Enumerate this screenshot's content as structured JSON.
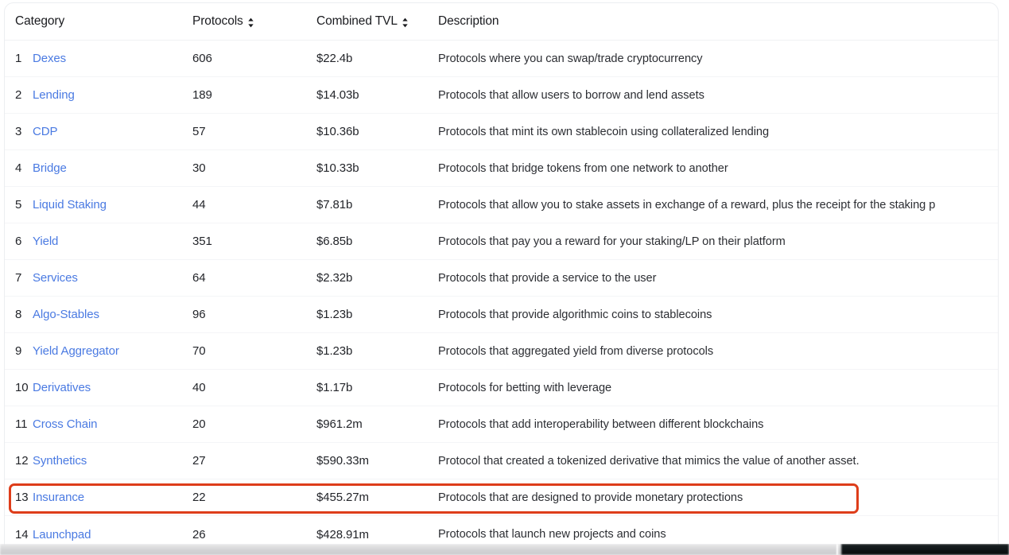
{
  "table": {
    "columns": {
      "category": "Category",
      "protocols": "Protocols",
      "combined_tvl": "Combined TVL",
      "description": "Description"
    },
    "sort_icon_name": "sort-updown-icon",
    "rows": [
      {
        "rank": "1",
        "category": "Dexes",
        "protocols": "606",
        "combined_tvl": "$22.4b",
        "description": "Protocols where you can swap/trade cryptocurrency"
      },
      {
        "rank": "2",
        "category": "Lending",
        "protocols": "189",
        "combined_tvl": "$14.03b",
        "description": "Protocols that allow users to borrow and lend assets"
      },
      {
        "rank": "3",
        "category": "CDP",
        "protocols": "57",
        "combined_tvl": "$10.36b",
        "description": "Protocols that mint its own stablecoin using collateralized lending"
      },
      {
        "rank": "4",
        "category": "Bridge",
        "protocols": "30",
        "combined_tvl": "$10.33b",
        "description": "Protocols that bridge tokens from one network to another"
      },
      {
        "rank": "5",
        "category": "Liquid Staking",
        "protocols": "44",
        "combined_tvl": "$7.81b",
        "description": "Protocols that allow you to stake assets in exchange of a reward, plus the receipt for the staking p"
      },
      {
        "rank": "6",
        "category": "Yield",
        "protocols": "351",
        "combined_tvl": "$6.85b",
        "description": "Protocols that pay you a reward for your staking/LP on their platform"
      },
      {
        "rank": "7",
        "category": "Services",
        "protocols": "64",
        "combined_tvl": "$2.32b",
        "description": "Protocols that provide a service to the user"
      },
      {
        "rank": "8",
        "category": "Algo-Stables",
        "protocols": "96",
        "combined_tvl": "$1.23b",
        "description": "Protocols that provide algorithmic coins to stablecoins"
      },
      {
        "rank": "9",
        "category": "Yield Aggregator",
        "protocols": "70",
        "combined_tvl": "$1.23b",
        "description": "Protocols that aggregated yield from diverse protocols"
      },
      {
        "rank": "10",
        "category": "Derivatives",
        "protocols": "40",
        "combined_tvl": "$1.17b",
        "description": "Protocols for betting with leverage"
      },
      {
        "rank": "11",
        "category": "Cross Chain",
        "protocols": "20",
        "combined_tvl": "$961.2m",
        "description": "Protocols that add interoperability between different blockchains"
      },
      {
        "rank": "12",
        "category": "Synthetics",
        "protocols": "27",
        "combined_tvl": "$590.33m",
        "description": "Protocol that created a tokenized derivative that mimics the value of another asset."
      },
      {
        "rank": "13",
        "category": "Insurance",
        "protocols": "22",
        "combined_tvl": "$455.27m",
        "description": "Protocols that are designed to provide monetary protections"
      },
      {
        "rank": "14",
        "category": "Launchpad",
        "protocols": "26",
        "combined_tvl": "$428.91m",
        "description": "Protocols that launch new projects and coins"
      }
    ]
  },
  "annotation": {
    "highlighted_row_rank": "13",
    "highlighted_row_category": "Insurance",
    "box_color": "#de3d1a"
  },
  "colors": {
    "link": "#4a7ae2",
    "text": "#23252a",
    "card_border": "#eceef1",
    "row_divider": "#f4f5f7",
    "highlight": "#de3d1a"
  }
}
